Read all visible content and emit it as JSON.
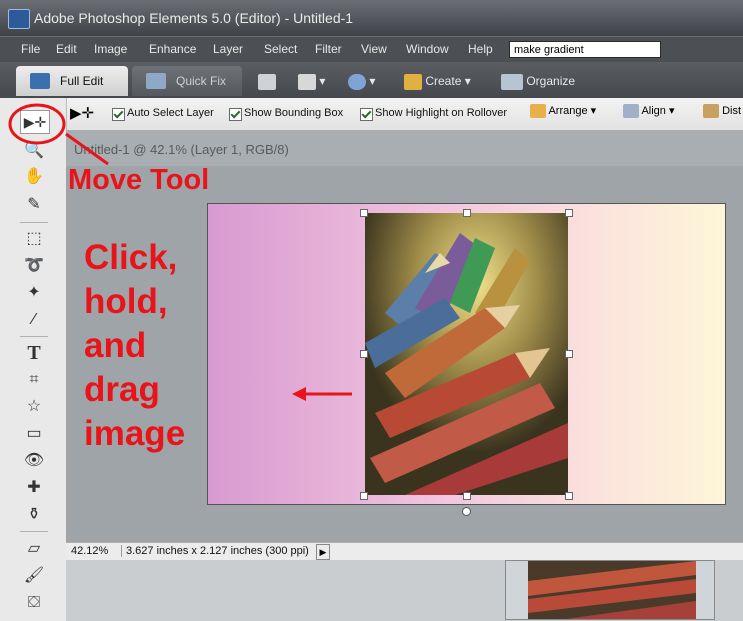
{
  "titlebar": {
    "title": "Adobe Photoshop Elements 5.0 (Editor) - Untitled-1"
  },
  "menu": {
    "items": [
      "File",
      "Edit",
      "Image",
      "Enhance",
      "Layer",
      "Select",
      "Filter",
      "View",
      "Window",
      "Help"
    ],
    "search_value": "make gradient"
  },
  "modebar": {
    "full_edit": "Full Edit",
    "quick_fix": "Quick Fix",
    "create": "Create",
    "organize": "Organize"
  },
  "options": {
    "auto_select_layer": "Auto Select Layer",
    "show_bounding_box": "Show Bounding Box",
    "show_highlight": "Show Highlight on Rollover",
    "arrange": "Arrange",
    "align": "Align",
    "distribute": "Dist"
  },
  "document": {
    "title": "Untitled-1 @ 42.1% (Layer 1, RGB/8)"
  },
  "status": {
    "zoom": "42.12%",
    "dimensions": "3.627 inches x 2.127 inches (300 ppi)"
  },
  "annotations": {
    "move_tool": "Move Tool",
    "instruction": [
      "Click,",
      "hold,",
      "and",
      "drag",
      "image"
    ]
  },
  "colors": {
    "annotation_red": "#e8141a",
    "gradient_left": "#d89ad0",
    "gradient_right": "#fdf6d8"
  }
}
